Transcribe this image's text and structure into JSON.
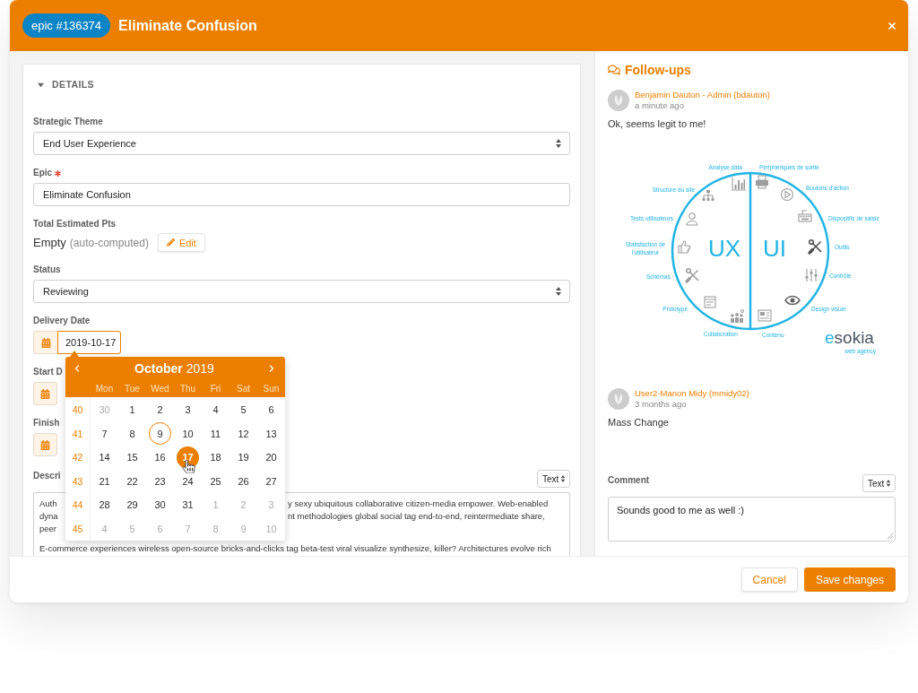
{
  "header": {
    "badge": "epic #136374",
    "title": "Eliminate Confusion"
  },
  "details": {
    "title": "DETAILS",
    "expanded": true,
    "strategic_theme": {
      "label": "Strategic Theme",
      "value": "End User Experience"
    },
    "epic": {
      "label": "Epic",
      "required": true,
      "value": "Eliminate Confusion"
    },
    "total_estimated_pts": {
      "label": "Total Estimated Pts",
      "value": "Empty",
      "note": "(auto-computed)",
      "button": "Edit"
    },
    "status": {
      "label": "Status",
      "value": "Reviewing"
    },
    "delivery_date": {
      "label": "Delivery Date",
      "value": "2019-10-17",
      "focused": true
    },
    "start_date": {
      "label": "Start D"
    },
    "finish_date": {
      "label": "Finish"
    },
    "description": {
      "label": "Descri",
      "format": "Text",
      "paragraphs": [
        [
          {
            "left": "Auth",
            "right": "y sexy ubiquitous collaborative citizen-media empower. Web-enabled"
          },
          {
            "left": "dyna",
            "right": "nt methodologies global social tag end-to-end, reintermediate share,"
          },
          {
            "left": "peer"
          }
        ],
        [
          {
            "left": "E-commerce experiences wireless open-source bricks-and-clicks tag beta-test viral visualize synthesize, killer? Architectures evolve rich"
          }
        ]
      ]
    }
  },
  "date_picker": {
    "month": "October",
    "year": "2019",
    "weekdays": [
      "Mon",
      "Tue",
      "Wed",
      "Thu",
      "Fri",
      "Sat",
      "Sun"
    ],
    "weeks": [
      {
        "number": "40",
        "days": [
          {
            "day": "30",
            "muted": true,
            "today": false,
            "selected": false
          },
          {
            "day": "1",
            "muted": false,
            "today": false,
            "selected": false
          },
          {
            "day": "2",
            "muted": false,
            "today": false,
            "selected": false
          },
          {
            "day": "3",
            "muted": false,
            "today": false,
            "selected": false
          },
          {
            "day": "4",
            "muted": false,
            "today": false,
            "selected": false
          },
          {
            "day": "5",
            "muted": false,
            "today": false,
            "selected": false
          },
          {
            "day": "6",
            "muted": false,
            "today": false,
            "selected": false
          }
        ]
      },
      {
        "number": "41",
        "days": [
          {
            "day": "7",
            "muted": false,
            "today": false,
            "selected": false
          },
          {
            "day": "8",
            "muted": false,
            "today": false,
            "selected": false
          },
          {
            "day": "9",
            "muted": false,
            "today": true,
            "selected": false
          },
          {
            "day": "10",
            "muted": false,
            "today": false,
            "selected": false
          },
          {
            "day": "11",
            "muted": false,
            "today": false,
            "selected": false
          },
          {
            "day": "12",
            "muted": false,
            "today": false,
            "selected": false
          },
          {
            "day": "13",
            "muted": false,
            "today": false,
            "selected": false
          }
        ]
      },
      {
        "number": "42",
        "days": [
          {
            "day": "14",
            "muted": false,
            "today": false,
            "selected": false
          },
          {
            "day": "15",
            "muted": false,
            "today": false,
            "selected": false
          },
          {
            "day": "16",
            "muted": false,
            "today": false,
            "selected": false
          },
          {
            "day": "17",
            "muted": false,
            "today": false,
            "selected": true
          },
          {
            "day": "18",
            "muted": false,
            "today": false,
            "selected": false
          },
          {
            "day": "19",
            "muted": false,
            "today": false,
            "selected": false
          },
          {
            "day": "20",
            "muted": false,
            "today": false,
            "selected": false
          }
        ]
      },
      {
        "number": "43",
        "days": [
          {
            "day": "21",
            "muted": false,
            "today": false,
            "selected": false
          },
          {
            "day": "22",
            "muted": false,
            "today": false,
            "selected": false
          },
          {
            "day": "23",
            "muted": false,
            "today": false,
            "selected": false
          },
          {
            "day": "24",
            "muted": false,
            "today": false,
            "selected": false
          },
          {
            "day": "25",
            "muted": false,
            "today": false,
            "selected": false
          },
          {
            "day": "26",
            "muted": false,
            "today": false,
            "selected": false
          },
          {
            "day": "27",
            "muted": false,
            "today": false,
            "selected": false
          }
        ]
      },
      {
        "number": "44",
        "days": [
          {
            "day": "28",
            "muted": false,
            "today": false,
            "selected": false
          },
          {
            "day": "29",
            "muted": false,
            "today": false,
            "selected": false
          },
          {
            "day": "30",
            "muted": false,
            "today": false,
            "selected": false
          },
          {
            "day": "31",
            "muted": false,
            "today": false,
            "selected": false
          },
          {
            "day": "1",
            "muted": true,
            "today": false,
            "selected": false
          },
          {
            "day": "2",
            "muted": true,
            "today": false,
            "selected": false
          },
          {
            "day": "3",
            "muted": true,
            "today": false,
            "selected": false
          }
        ]
      },
      {
        "number": "45",
        "days": [
          {
            "day": "4",
            "muted": true,
            "today": false,
            "selected": false
          },
          {
            "day": "5",
            "muted": true,
            "today": false,
            "selected": false
          },
          {
            "day": "6",
            "muted": true,
            "today": false,
            "selected": false
          },
          {
            "day": "7",
            "muted": true,
            "today": false,
            "selected": false
          },
          {
            "day": "8",
            "muted": true,
            "today": false,
            "selected": false
          },
          {
            "day": "9",
            "muted": true,
            "today": false,
            "selected": false
          },
          {
            "day": "10",
            "muted": true,
            "today": false,
            "selected": false
          }
        ]
      }
    ]
  },
  "followups": {
    "title": "Follow-ups",
    "items": [
      {
        "author": "Benjamin Dauton - Admin (bdauton)",
        "time": "a minute ago",
        "message": "Ok, seems legit to me!",
        "attachment": {
          "left_title": "UX",
          "right_title": "UI",
          "left_labels": [
            [
              "Analyse data"
            ],
            [
              "Structure du site"
            ],
            [
              "Tests utilisateurs"
            ],
            [
              "Statisfaction de",
              "l'utilisateur"
            ],
            [
              "Schémas"
            ],
            [
              "Prototype"
            ],
            [
              "Collaboration"
            ]
          ],
          "right_labels": [
            [
              "Périphériques de sortie"
            ],
            [
              "Boutons d'action"
            ],
            [
              "Dispositifs de saisie"
            ],
            [
              "Outils"
            ],
            [
              "Contrôle"
            ],
            [
              "Design visuel"
            ],
            [
              "Contenu"
            ]
          ],
          "logo": "esokia",
          "tagline": "web agency"
        }
      },
      {
        "author": "User2-Manon Midy (mmidy02)",
        "time": "3 months ago",
        "message": "Mass Change"
      }
    ]
  },
  "comment": {
    "label": "Comment",
    "format": "Text",
    "value": "Sounds good to me as well :)"
  },
  "footer": {
    "buttons": [
      {
        "label": "Cancel",
        "kind": "secondary"
      },
      {
        "label": "Save changes",
        "kind": "primary"
      }
    ]
  }
}
